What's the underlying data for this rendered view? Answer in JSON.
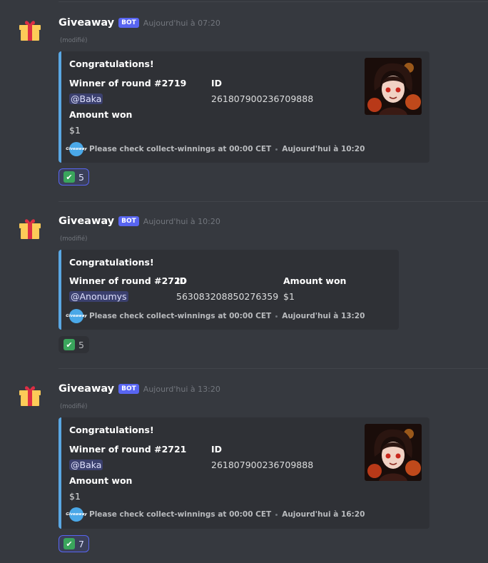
{
  "messages": [
    {
      "username": "Giveaway",
      "bot_tag": "BOT",
      "timestamp": "Aujourd'hui à 07:20",
      "edited": "(modifié)",
      "embed": {
        "title": "Congratulations!",
        "winner_label": "Winner of round #2719",
        "winner_value": "@Baka",
        "id_label": "ID",
        "id_value": "261807900236709888",
        "amount_label": "Amount won",
        "amount_value": "$1",
        "footer_icon_text": "Giveaway",
        "footer_text": "Please check collect-winnings at 00:00 CET",
        "footer_time": "Aujourd'hui à 10:20"
      },
      "reaction": {
        "emoji": "✔",
        "count": "5",
        "reacted": true
      }
    },
    {
      "username": "Giveaway",
      "bot_tag": "BOT",
      "timestamp": "Aujourd'hui à 10:20",
      "edited": "(modifié)",
      "embed": {
        "title": "Congratulations!",
        "winner_label": "Winner of round #2720",
        "winner_value": "@Anonumys",
        "id_label": "ID",
        "id_value": "563083208850276359",
        "amount_label": "Amount won",
        "amount_value": "$1",
        "footer_icon_text": "Giveaway",
        "footer_text": "Please check collect-winnings at 00:00 CET",
        "footer_time": "Aujourd'hui à 13:20"
      },
      "reaction": {
        "emoji": "✔",
        "count": "5",
        "reacted": false
      }
    },
    {
      "username": "Giveaway",
      "bot_tag": "BOT",
      "timestamp": "Aujourd'hui à 13:20",
      "edited": "(modifié)",
      "embed": {
        "title": "Congratulations!",
        "winner_label": "Winner of round #2721",
        "winner_value": "@Baka",
        "id_label": "ID",
        "id_value": "261807900236709888",
        "amount_label": "Amount won",
        "amount_value": "$1",
        "footer_icon_text": "Giveaway",
        "footer_text": "Please check collect-winnings at 00:00 CET",
        "footer_time": "Aujourd'hui à 16:20"
      },
      "reaction": {
        "emoji": "✔",
        "count": "7",
        "reacted": true
      }
    }
  ],
  "colors": {
    "background": "#36393f",
    "embed_bg": "#2f3136",
    "embed_accent": "#5aa7e3",
    "bot_tag": "#5865f2",
    "reaction_active_border": "#5865f2",
    "check_green": "#3aa55c"
  },
  "icons": {
    "avatar": "gift-icon",
    "thumbnail": "anime-avatar-thumbnail",
    "reaction": "check-mark-icon"
  }
}
